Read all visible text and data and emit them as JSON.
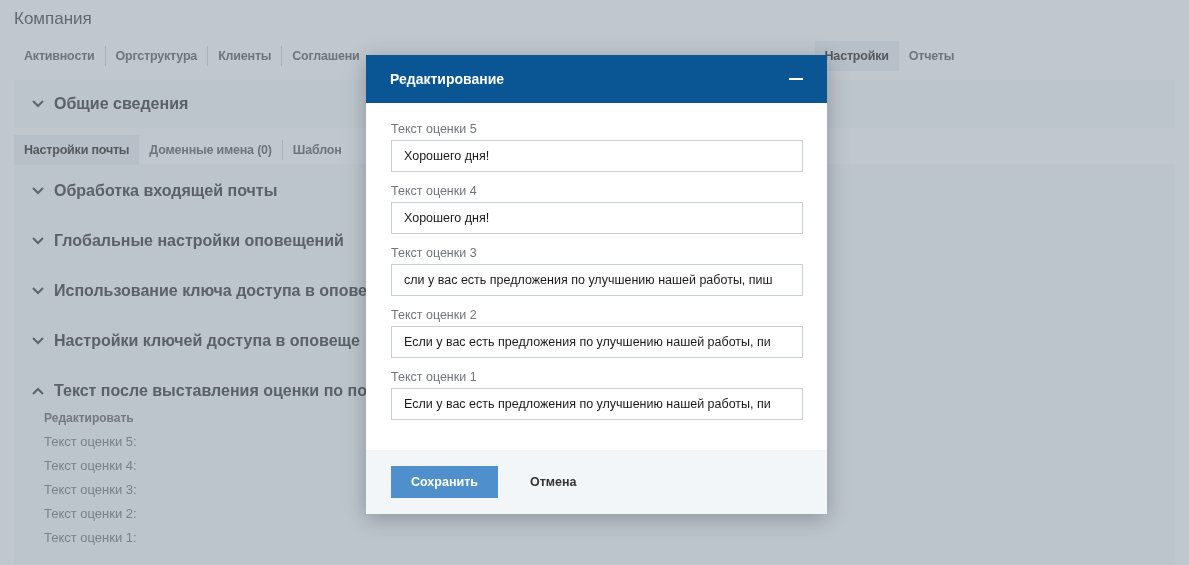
{
  "page": {
    "title": "Компания"
  },
  "tabs": [
    {
      "label": "Активности",
      "selected": false
    },
    {
      "label": "Оргструктура",
      "selected": false
    },
    {
      "label": "Клиенты",
      "selected": false
    },
    {
      "label": "Соглашени",
      "selected": false
    }
  ],
  "tabs_right": [
    {
      "label": "Настройки",
      "selected": true
    },
    {
      "label": "Отчеты",
      "selected": false
    }
  ],
  "general_section": {
    "title": "Общие сведения",
    "expanded": false
  },
  "subtabs": [
    {
      "label": "Настройки почты",
      "selected": true
    },
    {
      "label": "Доменные имена (0)",
      "selected": false
    },
    {
      "label": "Шаблон",
      "selected": false
    }
  ],
  "sections": [
    {
      "title": "Обработка входящей почты",
      "expanded": false
    },
    {
      "title": "Глобальные настройки оповещений",
      "expanded": false
    },
    {
      "title": "Использование ключа доступа в опове",
      "expanded": false
    },
    {
      "title": "Настройки ключей доступа в оповеще",
      "expanded": false
    },
    {
      "title": "Текст после выставления оценки по по",
      "expanded": true
    }
  ],
  "rating_block": {
    "edit_link": "Редактировать",
    "lines": [
      "Текст оценки 5:",
      "Текст оценки 4:",
      "Текст оценки 3:",
      "Текст оценки 2:",
      "Текст оценки 1:"
    ]
  },
  "dialog": {
    "title": "Редактирование",
    "fields": [
      {
        "label": "Текст оценки 5",
        "value": "Хорошего дня!"
      },
      {
        "label": "Текст оценки 4",
        "value": "Хорошего дня!"
      },
      {
        "label": "Текст оценки 3",
        "value": "сли у вас есть предложения по улучшению нашей работы, пиш"
      },
      {
        "label": "Текст оценки 2",
        "value": "Если у вас есть предложения по улучшению нашей работы, пи"
      },
      {
        "label": "Текст оценки 1",
        "value": "Если у вас есть предложения по улучшению нашей работы, пи"
      }
    ],
    "buttons": [
      {
        "label": "Сохранить",
        "kind": "primary"
      },
      {
        "label": "Отмена",
        "kind": "secondary"
      }
    ]
  }
}
